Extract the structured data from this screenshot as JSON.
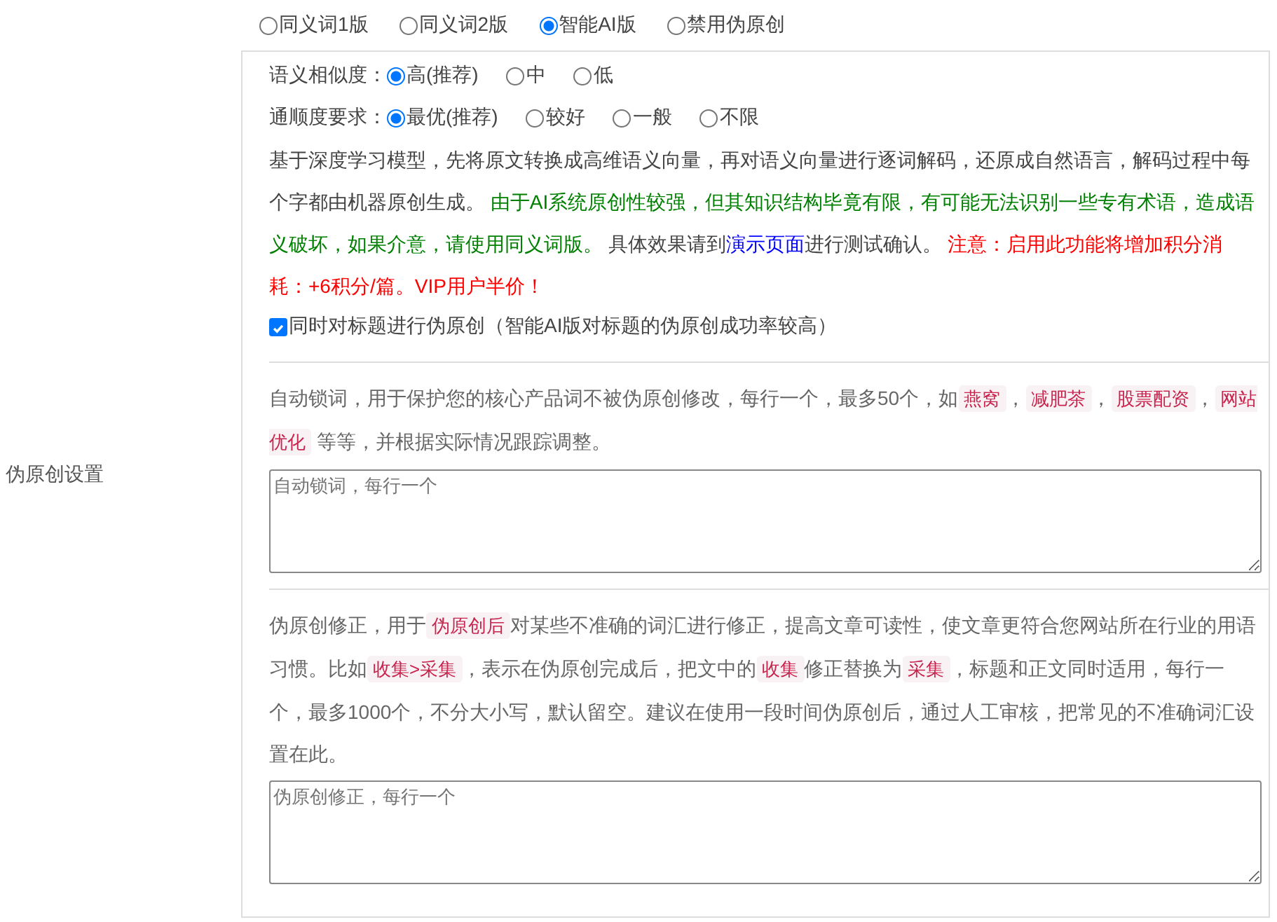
{
  "section_label": "伪原创设置",
  "modes": [
    {
      "label": "同义词1版",
      "selected": false
    },
    {
      "label": "同义词2版",
      "selected": false
    },
    {
      "label": "智能AI版",
      "selected": true
    },
    {
      "label": "禁用伪原创",
      "selected": false
    }
  ],
  "ai_options": [
    {
      "label": "语义相似度：",
      "options": [
        {
          "label": "高(推荐)",
          "selected": true
        },
        {
          "label": "中",
          "selected": false
        },
        {
          "label": "低",
          "selected": false
        }
      ]
    },
    {
      "label": "通顺度要求：",
      "options": [
        {
          "label": "最优(推荐)",
          "selected": true
        },
        {
          "label": "较好",
          "selected": false
        },
        {
          "label": "一般",
          "selected": false
        },
        {
          "label": "不限",
          "selected": false
        }
      ]
    }
  ],
  "description": [
    {
      "kind": "plain",
      "text": "基于深度学习模型，先将原文转换成高维语义向量，再对语义向量进行逐词解码，还原成自然语言，解码过程中每个字都由机器原创生成。 "
    },
    {
      "kind": "green",
      "text": "由于AI系统原创性较强，但其知识结构毕竟有限，有可能无法识别一些专有术语，造成语义破坏，如果介意，请使用同义词版。"
    },
    {
      "kind": "plain",
      "text": " 具体效果请到"
    },
    {
      "kind": "link",
      "text": "演示页面"
    },
    {
      "kind": "plain",
      "text": "进行测试确认。 "
    },
    {
      "kind": "red",
      "text": "注意：启用此功能将增加积分消耗：+6积分/篇。VIP用户半价！"
    }
  ],
  "title_checkbox": {
    "label": "同时对标题进行伪原创（智能AI版对标题的伪原创成功率较高）",
    "checked": true
  },
  "lock_words": {
    "segments": [
      {
        "kind": "text",
        "text": "自动锁词，用于保护您的核心产品词不被伪原创修改，每行一个，最多50个，如"
      },
      {
        "kind": "tag",
        "text": "燕窝"
      },
      {
        "kind": "text",
        "text": "，"
      },
      {
        "kind": "tag",
        "text": "减肥茶"
      },
      {
        "kind": "text",
        "text": "，"
      },
      {
        "kind": "tag",
        "text": "股票配资"
      },
      {
        "kind": "text",
        "text": "，"
      },
      {
        "kind": "tag",
        "text": "网站优化"
      },
      {
        "kind": "text",
        "text": " 等等，并根据实际情况跟踪调整。"
      }
    ],
    "placeholder": "自动锁词，每行一个"
  },
  "correction": {
    "segments": [
      {
        "kind": "text",
        "text": "伪原创修正，用于"
      },
      {
        "kind": "tag",
        "text": "伪原创后"
      },
      {
        "kind": "text",
        "text": "对某些不准确的词汇进行修正，提高文章可读性，使文章更符合您网站所在行业的用语习惯。比如"
      },
      {
        "kind": "tag",
        "text": "收集>采集"
      },
      {
        "kind": "text",
        "text": "，表示在伪原创完成后，把文中的"
      },
      {
        "kind": "tag",
        "text": "收集"
      },
      {
        "kind": "text",
        "text": "修正替换为"
      },
      {
        "kind": "tag",
        "text": "采集"
      },
      {
        "kind": "text",
        "text": "，标题和正文同时适用，每行一个，最多1000个，不分大小写，默认留空。建议在使用一段时间伪原创后，通过人工审核，把常见的不准确词汇设置在此。"
      }
    ],
    "placeholder": "伪原创修正，每行一个"
  }
}
